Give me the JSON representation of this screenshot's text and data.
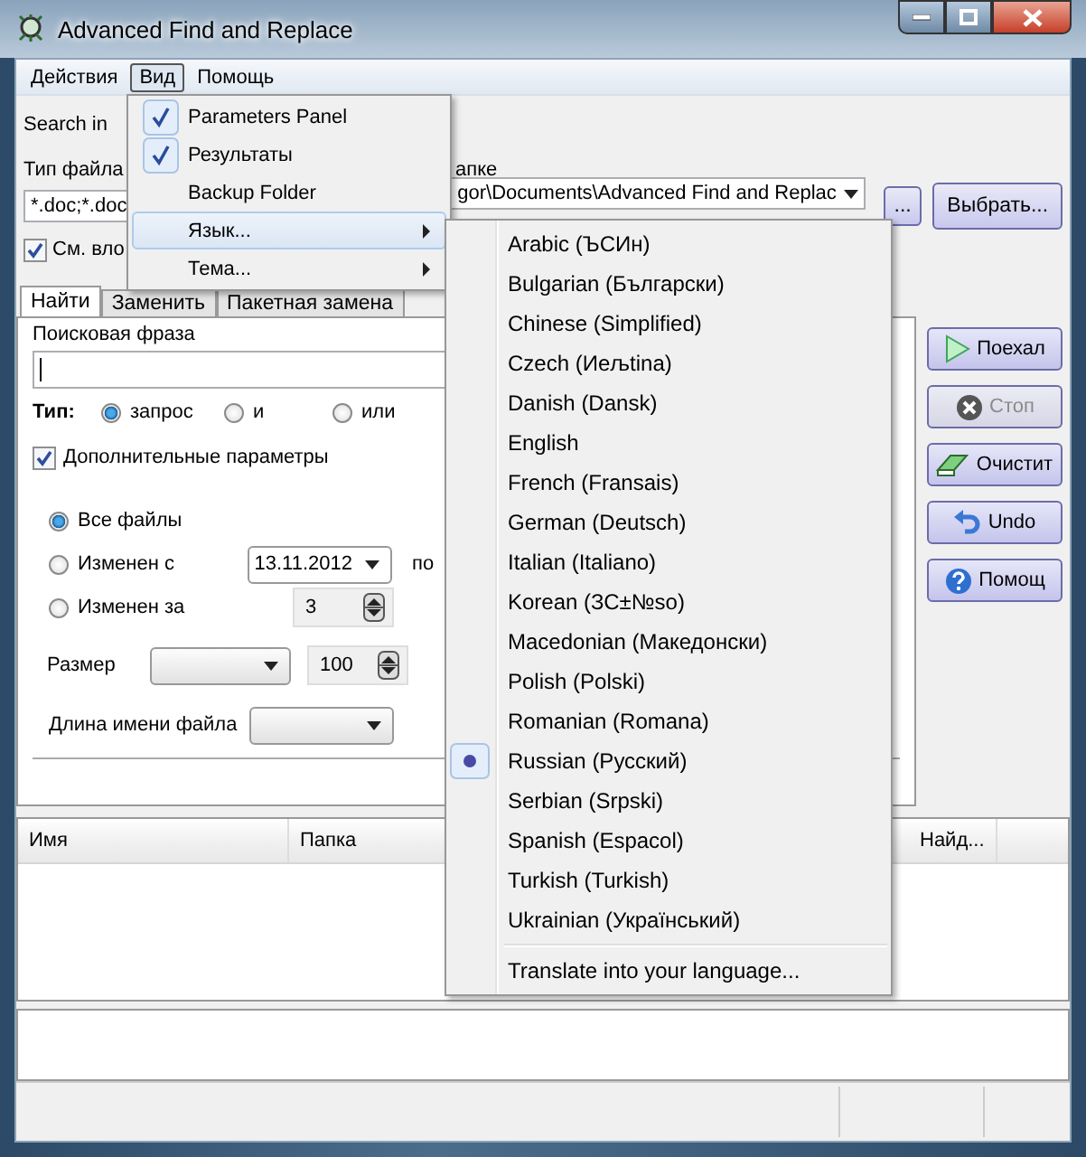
{
  "window": {
    "title": "Advanced Find and Replace"
  },
  "menu_bar": [
    {
      "label": "Действия",
      "selected": false
    },
    {
      "label": "Вид",
      "selected": true
    },
    {
      "label": "Помощь",
      "selected": false
    }
  ],
  "view_menu": [
    {
      "label": "Parameters Panel",
      "kind": "check",
      "checked": true,
      "selected": false
    },
    {
      "label": "Результаты",
      "kind": "check",
      "checked": true,
      "selected": false
    },
    {
      "label": "Backup Folder",
      "kind": "check",
      "checked": false,
      "selected": false
    },
    {
      "label": "Язык...",
      "kind": "submenu",
      "checked": false,
      "selected": true
    },
    {
      "label": "Тема...",
      "kind": "submenu",
      "checked": false,
      "selected": false
    }
  ],
  "language_menu": {
    "items": [
      {
        "label": "Arabic (ЪСИн)",
        "selected": false
      },
      {
        "label": "Bulgarian (Български)",
        "selected": false
      },
      {
        "label": "Chinese (Simplified)",
        "selected": false
      },
      {
        "label": "Czech (Иељtina)",
        "selected": false
      },
      {
        "label": "Danish (Dansk)",
        "selected": false
      },
      {
        "label": "English",
        "selected": false
      },
      {
        "label": "French (Fransais)",
        "selected": false
      },
      {
        "label": "German (Deutsch)",
        "selected": false
      },
      {
        "label": "Italian (Italiano)",
        "selected": false
      },
      {
        "label": "Korean (ЗС±№so)",
        "selected": false
      },
      {
        "label": "Macedonian (Македонски)",
        "selected": false
      },
      {
        "label": "Polish (Polski)",
        "selected": false
      },
      {
        "label": "Romanian (Romana)",
        "selected": false
      },
      {
        "label": "Russian (Русский)",
        "selected": true
      },
      {
        "label": "Serbian (Srpski)",
        "selected": false
      },
      {
        "label": "Spanish (Espacol)",
        "selected": false
      },
      {
        "label": "Turkish (Turkish)",
        "selected": false
      },
      {
        "label": "Ukrainian (Український)",
        "selected": false
      }
    ],
    "footer": "Translate into your language..."
  },
  "search_in": {
    "label": "Search in"
  },
  "file_type": {
    "label": "Тип файла",
    "value": "*.doc;*.doc"
  },
  "folder": {
    "label": "апке",
    "value": "gor\\Documents\\Advanced Find and Replac",
    "browse_button": "...",
    "choose_button": "Выбрать..."
  },
  "subfolders": {
    "label": "См. вло",
    "checked": true
  },
  "tabs": [
    {
      "label": "Найти",
      "selected": true
    },
    {
      "label": "Заменить",
      "selected": false
    },
    {
      "label": "Пакетная замена",
      "selected": false
    }
  ],
  "search_phrase": {
    "label": "Поисковая фраза"
  },
  "search_type": {
    "label": "Тип:",
    "options": [
      {
        "label": "запрос",
        "selected": true
      },
      {
        "label": "и",
        "selected": false
      },
      {
        "label": "или",
        "selected": false
      }
    ]
  },
  "advanced": {
    "label": "Дополнительные параметры",
    "checked": true
  },
  "date_filter": {
    "options": [
      {
        "label": "Все файлы",
        "selected": true
      },
      {
        "label": "Изменен с",
        "selected": false
      },
      {
        "label": "Изменен за",
        "selected": false
      }
    ],
    "from_date": "13.11.2012",
    "to_label": "по",
    "days": "3"
  },
  "size": {
    "label": "Размер",
    "value": "100"
  },
  "name_length": {
    "label": "Длина имени файла"
  },
  "actions": [
    {
      "label": "Поехал",
      "kind": "play",
      "disabled": false
    },
    {
      "label": "Стоп",
      "kind": "stop",
      "disabled": true
    },
    {
      "label": "Очистит",
      "kind": "clear",
      "disabled": false
    },
    {
      "label": "Undo",
      "kind": "undo",
      "disabled": false
    },
    {
      "label": "Помощ",
      "kind": "help",
      "disabled": false
    }
  ],
  "results": {
    "columns": [
      "Имя",
      "Папка",
      "Найд..."
    ]
  }
}
